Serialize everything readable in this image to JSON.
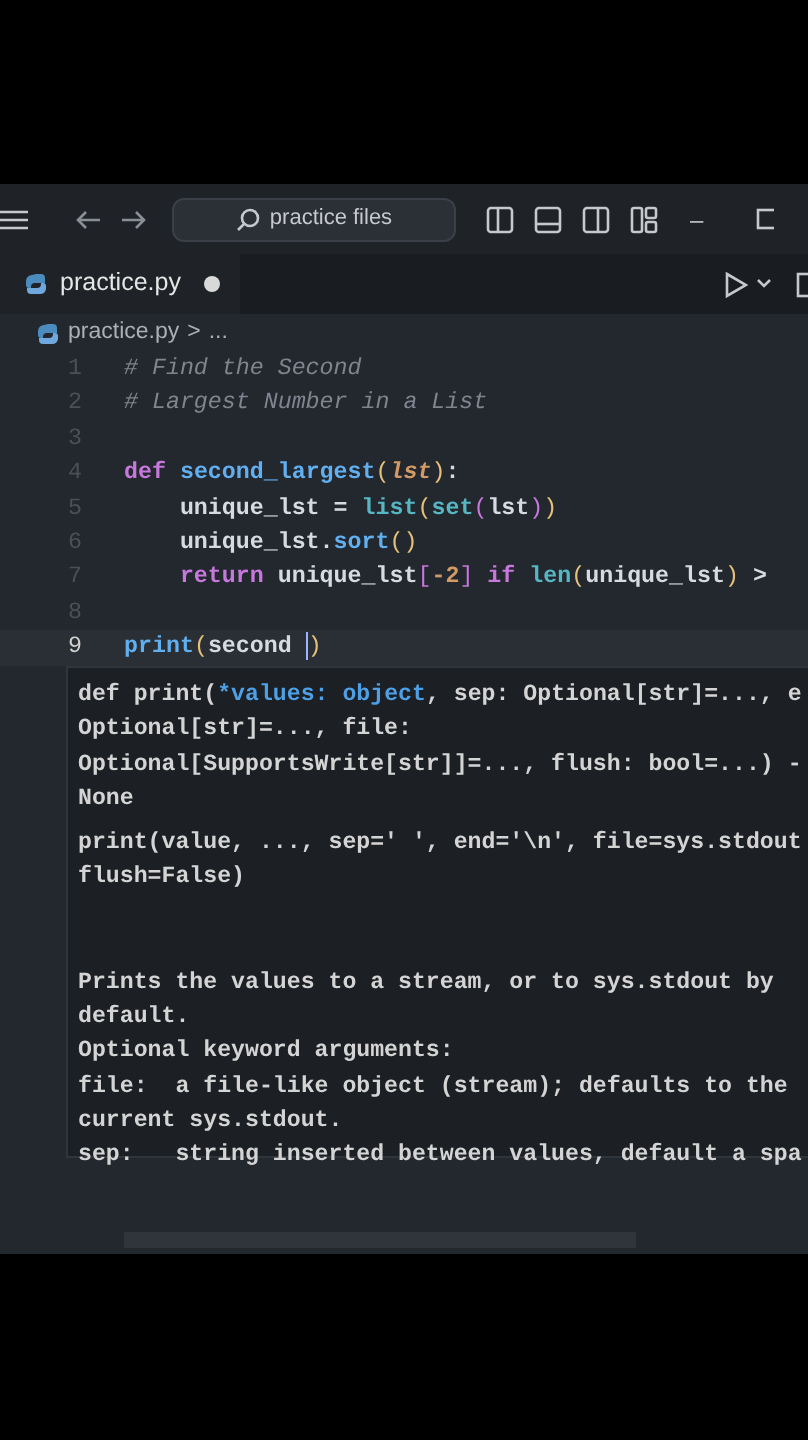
{
  "title_bar": {
    "search": "practice files",
    "minimize": "–"
  },
  "tabs": [
    {
      "label": "practice.py",
      "selected": true,
      "modified": true
    }
  ],
  "breadcrumb": {
    "file": "practice.py",
    "separator": ">",
    "rest": "..."
  },
  "code": [
    {
      "number": "1",
      "current": false,
      "tokens": [
        {
          "kind": "comment",
          "text": "# Find the Second"
        }
      ]
    },
    {
      "number": "2",
      "current": false,
      "tokens": [
        {
          "kind": "comment",
          "text": "# Largest Number in a List"
        }
      ]
    },
    {
      "number": "3",
      "current": false
    },
    {
      "number": "4",
      "current": false,
      "tokens": [
        {
          "kind": "keyword",
          "text": "def "
        },
        {
          "kind": "function",
          "text": "second_largest"
        },
        {
          "kind": "paren",
          "text": "("
        },
        {
          "kind": "param",
          "text": "lst"
        },
        {
          "kind": "paren",
          "text": ")"
        },
        {
          "kind": "plain",
          "text": ":"
        }
      ]
    },
    {
      "number": "5",
      "current": false,
      "tokens": [
        {
          "kind": "plain",
          "text": "    unique_lst = "
        },
        {
          "kind": "builtin",
          "text": "list"
        },
        {
          "kind": "paren",
          "text": "("
        },
        {
          "kind": "builtin",
          "text": "set"
        },
        {
          "kind": "paren2",
          "text": "("
        },
        {
          "kind": "plain",
          "text": "lst"
        },
        {
          "kind": "paren2",
          "text": ")"
        },
        {
          "kind": "paren",
          "text": ")"
        }
      ]
    },
    {
      "number": "6",
      "current": false,
      "tokens": [
        {
          "kind": "plain",
          "text": "    unique_lst."
        },
        {
          "kind": "function",
          "text": "sort"
        },
        {
          "kind": "paren",
          "text": "()"
        }
      ]
    },
    {
      "number": "7",
      "current": false,
      "tokens": [
        {
          "kind": "keyword",
          "text": "    return"
        },
        {
          "kind": "plain",
          "text": " unique_lst"
        },
        {
          "kind": "paren2",
          "text": "["
        },
        {
          "kind": "number",
          "text": "-2"
        },
        {
          "kind": "paren2",
          "text": "]"
        },
        {
          "kind": "keyword",
          "text": " if "
        },
        {
          "kind": "builtin",
          "text": "len"
        },
        {
          "kind": "paren",
          "text": "("
        },
        {
          "kind": "plain",
          "text": "unique_lst"
        },
        {
          "kind": "paren",
          "text": ")"
        },
        {
          "kind": "plain",
          "text": " >"
        }
      ]
    },
    {
      "number": "8",
      "current": false
    },
    {
      "number": "9",
      "current": true,
      "tokens": [
        {
          "kind": "function",
          "text": "print"
        },
        {
          "kind": "paren",
          "text": "("
        },
        {
          "kind": "plain",
          "text": "second "
        },
        {
          "kind": "paren",
          "text": ")"
        }
      ]
    }
  ],
  "hover": {
    "signature": [
      [
        {
          "kind": "plain",
          "text": "def print("
        },
        {
          "kind": "param",
          "text": "*values: object"
        },
        {
          "kind": "plain",
          "text": ", sep: Optional[str]=..., e"
        }
      ],
      [
        {
          "kind": "plain",
          "text": "Optional[str]=..., file:"
        }
      ],
      [
        {
          "kind": "plain",
          "text": "Optional[SupportsWrite[str]]=..., flush: bool=...) -"
        }
      ],
      [
        {
          "kind": "plain",
          "text": "None"
        }
      ]
    ],
    "usage": [
      "print(value, ..., sep=' ', end='\\n', file=sys.stdout",
      "flush=False)"
    ],
    "doc": [
      "Prints the values to a stream, or to sys.stdout by",
      "default.",
      "Optional keyword arguments:",
      "file:  a file-like object (stream); defaults to the",
      "current sys.stdout.",
      "sep:   string inserted between values, default a spa"
    ]
  }
}
